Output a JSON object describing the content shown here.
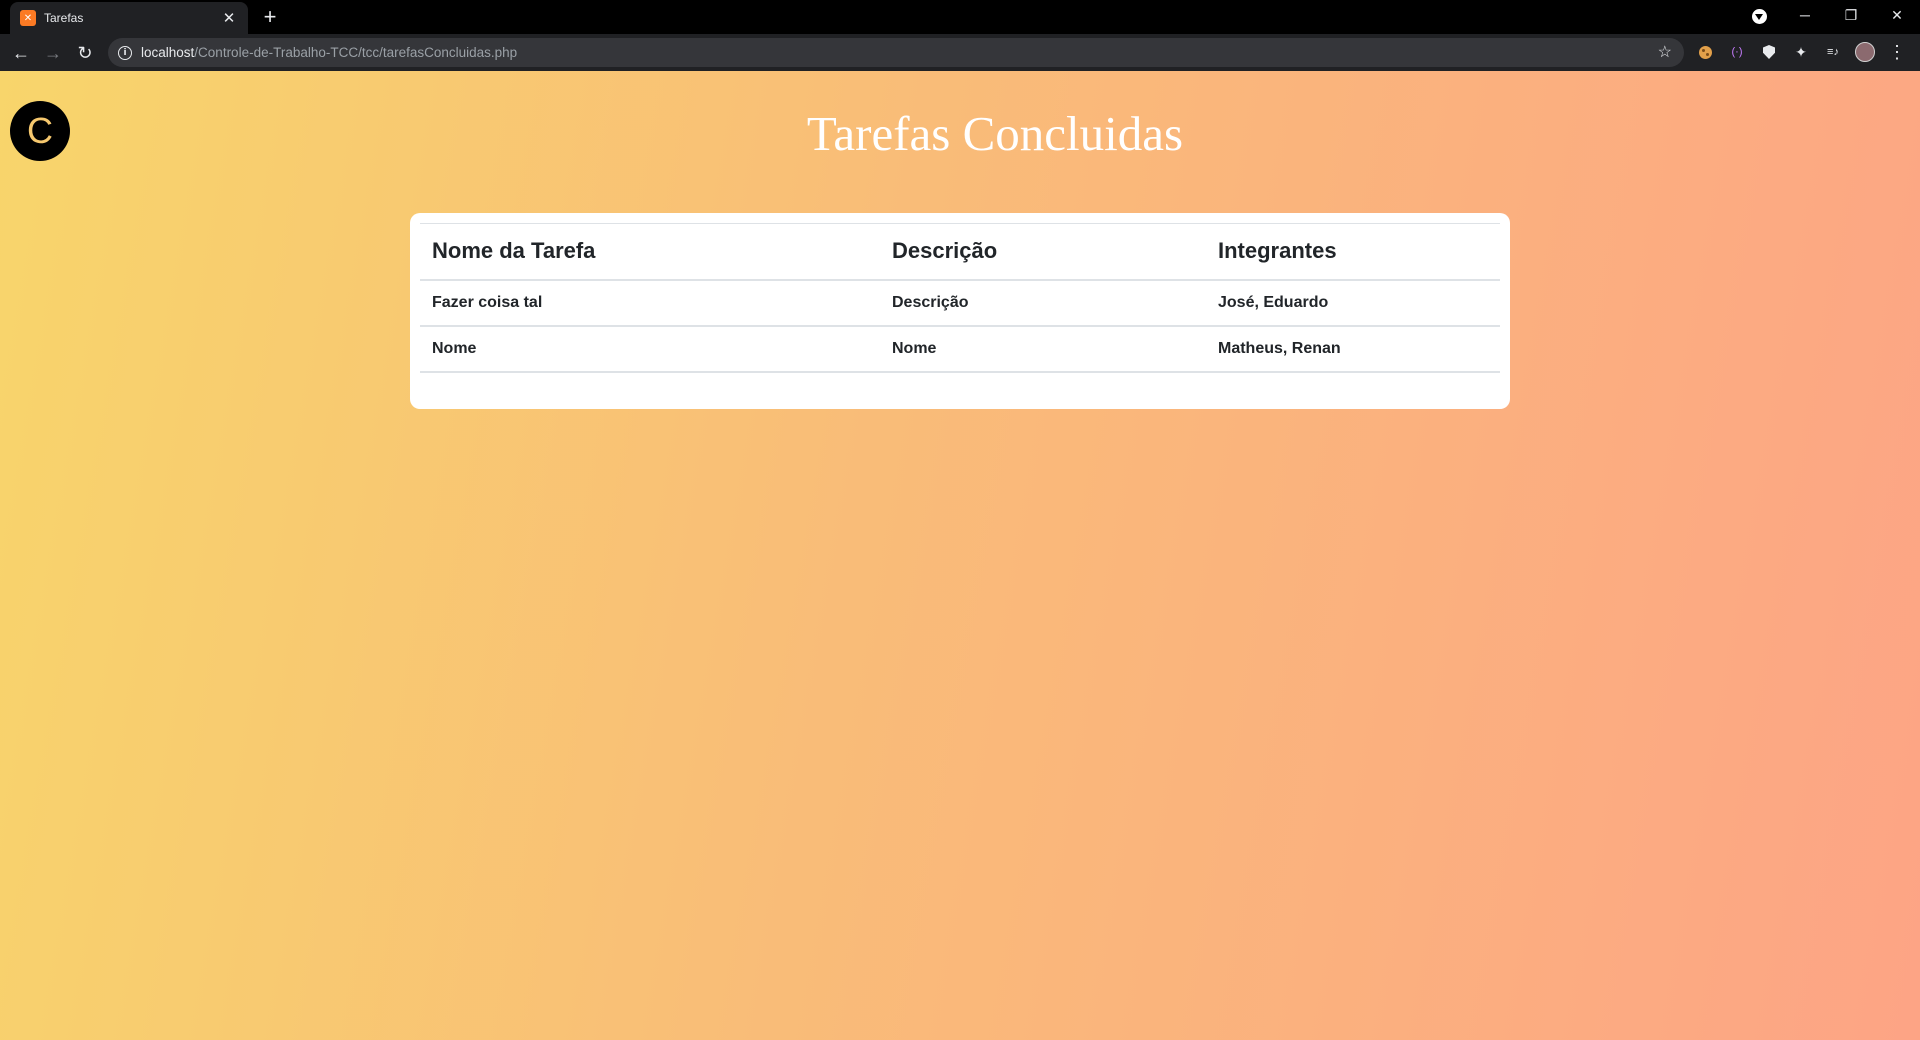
{
  "browser": {
    "tab": {
      "favicon": "xampp-favicon",
      "title": "Tarefas",
      "close": "✕"
    },
    "new_tab": "+",
    "url": {
      "host": "localhost",
      "path": "/Controle-de-Trabalho-TCC/tcc/tarefasConcluidas.php"
    },
    "window_controls": {
      "minimize": "─",
      "restore": "❐",
      "close": "✕"
    },
    "nav": {
      "back": "←",
      "forward": "→",
      "reload": "↻",
      "info": "i",
      "star": "☆",
      "menu": "⋮"
    },
    "extensions": {
      "puzzle": "✦",
      "media": "≡♪",
      "bracket": "(·)"
    }
  },
  "page": {
    "logo_letter": "C",
    "title": "Tarefas Concluidas",
    "table": {
      "headers": [
        "Nome da Tarefa",
        "Descrição",
        "Integrantes"
      ],
      "rows": [
        [
          "Fazer coisa tal",
          "Descrição",
          "José, Eduardo"
        ],
        [
          "Nome",
          "Nome",
          "Matheus, Renan"
        ]
      ]
    }
  }
}
